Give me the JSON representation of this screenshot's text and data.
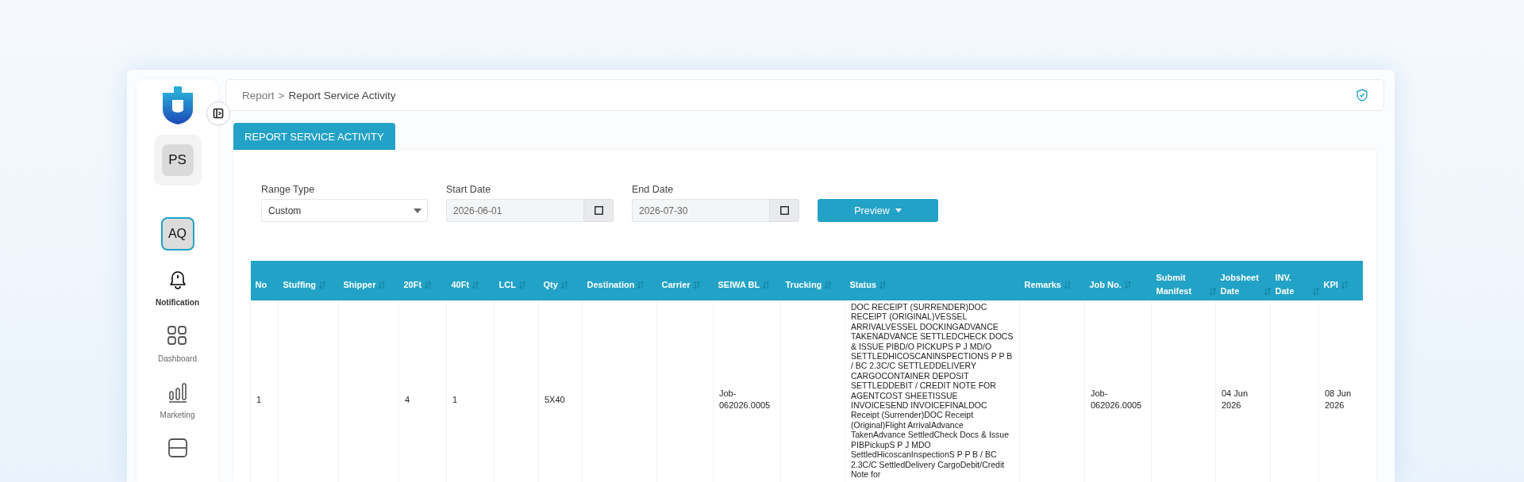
{
  "breadcrumb": {
    "items": [
      {
        "label": "Report"
      },
      {
        "label": "Report Service Activity"
      }
    ],
    "separator": ">"
  },
  "sidebar": {
    "avatar": "PS",
    "user_button": {
      "label": "AQ",
      "selected": true
    },
    "items": [
      {
        "label": "Notification",
        "selected": true
      },
      {
        "label": "Dashboard",
        "selected": false
      },
      {
        "label": "Marketing",
        "selected": false
      },
      {
        "selected": false
      }
    ]
  },
  "tabs": [
    {
      "label": "REPORT SERVICE ACTIVITY",
      "selected": true
    }
  ],
  "filters": {
    "range_type": {
      "label": "Range Type",
      "value": "Custom"
    },
    "start_date": {
      "label": "Start Date",
      "value": "2026-06-01"
    },
    "end_date": {
      "label": "End Date",
      "value": "2026-07-30"
    },
    "preview_button": "Preview"
  },
  "table": {
    "columns": [
      {
        "label": "No",
        "sortable": false
      },
      {
        "label": "Stuffing",
        "sortable": true
      },
      {
        "label": "Shipper",
        "sortable": true
      },
      {
        "label": "20Ft",
        "sortable": true
      },
      {
        "label": "40Ft",
        "sortable": true
      },
      {
        "label": "LCL",
        "sortable": true
      },
      {
        "label": "Qty",
        "sortable": true
      },
      {
        "label": "Destination",
        "sortable": true
      },
      {
        "label": "Carrier",
        "sortable": true
      },
      {
        "label": "SEIWA BL",
        "sortable": true
      },
      {
        "label": "Trucking",
        "sortable": true
      },
      {
        "label": "Status",
        "sortable": true
      },
      {
        "label": "Remarks",
        "sortable": true
      },
      {
        "label": "Job No.",
        "sortable": true
      },
      {
        "label": "Submit Manifest",
        "sortable": true
      },
      {
        "label": "Jobsheet Date",
        "sortable": true
      },
      {
        "label": "INV. Date",
        "sortable": true
      },
      {
        "label": "KPI",
        "sortable": true
      }
    ],
    "rows": [
      [
        "1",
        "",
        "",
        "4",
        "1",
        "",
        "5X40",
        "",
        "",
        "Job-062026.0005",
        "",
        "DOC RECEIPT (SURRENDER)DOC RECEIPT (ORIGINAL)VESSEL ARRIVALVESSEL DOCKINGADVANCE TAKENADVANCE SETTLEDCHECK DOCS & ISSUE PIBD/O PICKUPS P J MD/O SETTLEDHICOSCANINSPECTIONS P P B / BC 2.3C/C SETTLEDDELIVERY CARGOCONTAINER DEPOSIT SETTLEDDEBIT / CREDIT NOTE FOR AGENTCOST SHEETISSUE INVOICESEND INVOICEFINALDOC Receipt (Surrender)DOC Receipt (Original)Flight ArrivalAdvance TakenAdvance SettledCheck Docs & Issue PIBPickupS P J MDO SettledHicoscanInspectionS P P B / BC 2.3C/C SettledDelivery CargoDebit/Credit Note for",
        "",
        "Job-062026.0005",
        "",
        "04 Jun 2026",
        "",
        "08 Jun 2026"
      ]
    ]
  }
}
